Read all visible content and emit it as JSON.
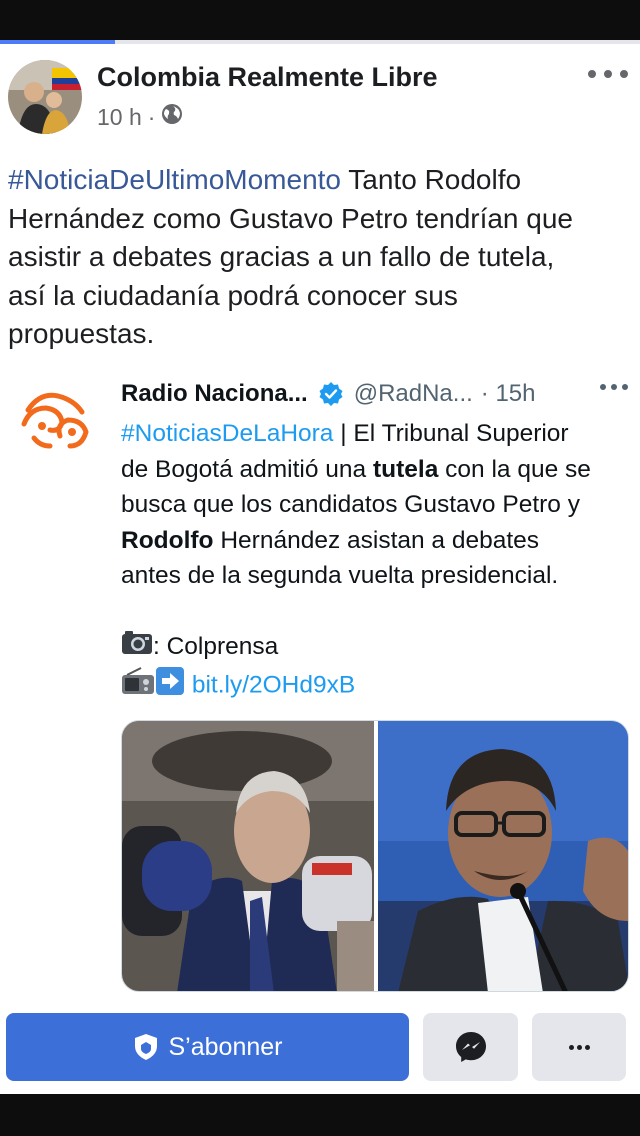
{
  "status_bar": {
    "progress": 0.18
  },
  "post": {
    "author": "Colombia Realmente Libre",
    "time": "10 h",
    "separator": "·",
    "privacy_icon": "globe-icon",
    "text_lines": [
      {
        "hashtag": "#NoticiaDeUltimoMomento",
        "rest": " Tanto Rodolfo"
      },
      {
        "text": "Hernández como Gustavo Petro tendrían que"
      },
      {
        "text": "asistir a debates gracias a un fallo de tutela,"
      },
      {
        "text": "así la ciudadanía podrá conocer sus"
      },
      {
        "text": "propuestas."
      }
    ]
  },
  "tweet": {
    "name": "Radio Naciona...",
    "handle": "@RadNa...",
    "time": "· 15h",
    "verified_icon": "verified-badge-icon",
    "body": {
      "hashtag": "#NoticiasDeLaHora",
      "l1_rest": " | El Tribunal Superior",
      "l2_a": "de Bogotá admitió una ",
      "l2_bold": "tutela",
      "l2_b": " con la que se",
      "l3": "busca que los candidatos Gustavo Petro y",
      "l4_bold": "Rodolfo",
      "l4_rest": " Hernández asistan a debates",
      "l5": "antes de la segunda vuelta presidencial.",
      "credit": ": Colprensa",
      "link": "bit.ly/2OHd9xB"
    },
    "icons": {
      "camera": "camera-icon",
      "radio": "radio-icon",
      "arrow": "arrow-right-icon"
    }
  },
  "actions": {
    "subscribe_label": "S’abonner",
    "subscribe_icon": "shield-icon",
    "messenger_icon": "messenger-icon",
    "more_icon": "more-icon"
  },
  "colors": {
    "accent": "#3c70d8",
    "hashtag": "#385898",
    "link": "#1d9bf0"
  }
}
